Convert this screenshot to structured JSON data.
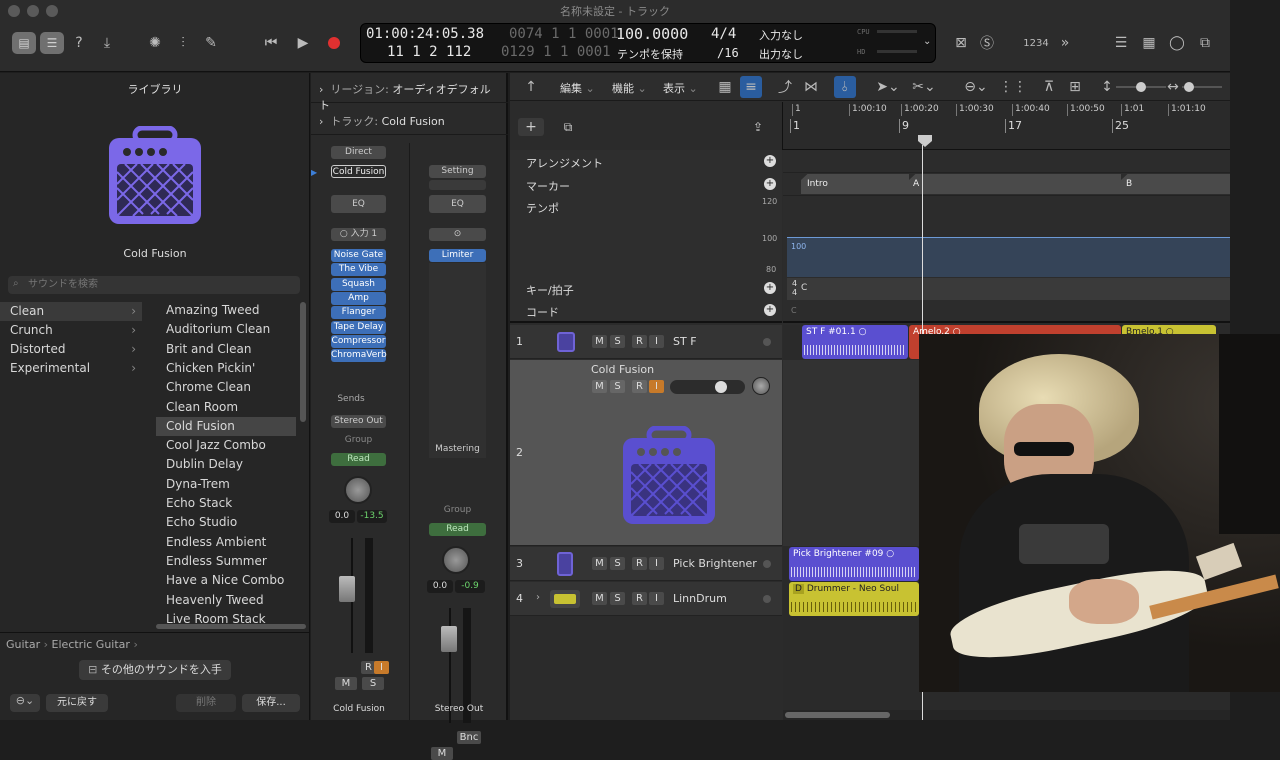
{
  "window": {
    "title": "名称未設定 - トラック"
  },
  "lcd": {
    "position": "01:00:24:05.38",
    "bars_dim_top": "0074 1 1 0001",
    "bars": "11 1 2 112",
    "bars_dim_bottom": "0129 1 1 0001",
    "tempo": "100.0000",
    "tempo_mode": "テンポを保持",
    "signature": "4/4",
    "division": "/16",
    "input": "入力なし",
    "output": "出力なし",
    "cpu_label": "CPU",
    "hd_label": "HD"
  },
  "toolbar": {
    "count_in": "1234"
  },
  "library": {
    "header": "ライブラリ",
    "preset_name": "Cold Fusion",
    "search_placeholder": "サウンドを検索",
    "categories": [
      "Clean",
      "Crunch",
      "Distorted",
      "Experimental"
    ],
    "patches": [
      "Amazing Tweed",
      "Auditorium Clean",
      "Brit and Clean",
      "Chicken Pickin'",
      "Chrome Clean",
      "Clean Room",
      "Cold Fusion",
      "Cool Jazz Combo",
      "Dublin Delay",
      "Dyna-Trem",
      "Echo Stack",
      "Echo Studio",
      "Endless Ambient",
      "Endless Summer",
      "Have a Nice Combo",
      "Heavenly Tweed",
      "Live Room Stack"
    ],
    "breadcrumb": [
      "Guitar",
      "Electric Guitar"
    ],
    "get_more": "その他のサウンドを入手",
    "revert": "元に戻す",
    "delete": "削除",
    "save": "保存..."
  },
  "inspector": {
    "region_label": "リージョン:",
    "region_value": "オーディオデフォルト",
    "track_label": "トラック:",
    "track_value": "Cold Fusion",
    "strip1": {
      "patch_button": "Direct",
      "setting": "Cold Fusion",
      "eq": "EQ",
      "input": "入力 1",
      "plugins": [
        "Noise Gate",
        "The Vibe",
        "Squash",
        "Amp",
        "Flanger",
        "Tape Delay",
        "Compressor",
        "ChromaVerb"
      ],
      "sends": "Sends",
      "output": "Stereo Out",
      "group": "Group",
      "automation": "Read",
      "pan": "0.0",
      "level": "-13.5",
      "r": "R",
      "i": "I",
      "m": "M",
      "s": "S",
      "name": "Cold Fusion"
    },
    "strip2": {
      "setting": "Setting",
      "eq": "EQ",
      "plugins": [
        "Limiter"
      ],
      "mastering": "Mastering",
      "group": "Group",
      "automation": "Read",
      "pan": "0.0",
      "level": "-0.9",
      "bnc": "Bnc",
      "m": "M",
      "name": "Stereo Out"
    }
  },
  "tracks_toolbar": {
    "edit": "編集",
    "functions": "機能",
    "view": "表示"
  },
  "ruler": {
    "times": [
      "1",
      "1:00:10",
      "1:00:20",
      "1:00:30",
      "1:00:40",
      "1:00:50",
      "1:01",
      "1:01:10"
    ],
    "bars": [
      "1",
      "9",
      "17",
      "25"
    ]
  },
  "global_tracks": {
    "arrangement": "アレンジメント",
    "marker": "マーカー",
    "tempo": "テンポ",
    "key_sig": "キー/拍子",
    "chord": "コード",
    "tempo_scale": [
      "120",
      "100",
      "80"
    ],
    "tempo_value": "100",
    "markers": [
      "Intro",
      "A",
      "B"
    ],
    "signature_top": "4",
    "signature_bottom": "4",
    "key": "C",
    "chord_value": "C"
  },
  "tracks": [
    {
      "num": "1",
      "name": "ST F"
    },
    {
      "num": "2",
      "name": "Cold Fusion"
    },
    {
      "num": "3",
      "name": "Pick Brightener"
    },
    {
      "num": "4",
      "name": "LinnDrum"
    }
  ],
  "track_buttons": {
    "m": "M",
    "s": "S",
    "r": "R",
    "i": "I"
  },
  "regions": {
    "r1": "ST F #01.1",
    "r2": "Amelo.2",
    "r3": "Bmelo.1",
    "r4": "Pick Brightener #09",
    "r5_flag": "D",
    "r5": "Drummer - Neo Soul"
  },
  "colors": {
    "purple": "#5a4fd0",
    "red": "#c0402e",
    "yellow": "#c8c232",
    "accent_blue": "#3d6fb8",
    "amp_purple": "#7b68e8"
  }
}
